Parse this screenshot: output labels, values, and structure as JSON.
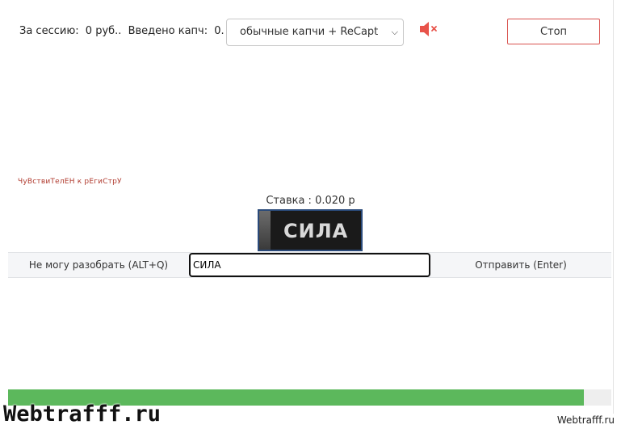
{
  "stats": {
    "session_label": "За сессию:",
    "session_value": "0 руб..",
    "entered_label": "Введено капч:",
    "entered_value": "0."
  },
  "mode_select": {
    "selected": "обычные капчи + ReCaptcha",
    "visible_text": "обычные капчи + ReCapt"
  },
  "sound": {
    "icon": "speaker-muted-icon",
    "color": "#e8534a"
  },
  "stop_button": {
    "label": "Стоп",
    "border_color": "#d9534f"
  },
  "case_note": "ЧуВствиТелЕН к рЕгиСтрУ",
  "rate": "Ставка : 0.020 р",
  "captcha": {
    "word": "СИЛА"
  },
  "answer": {
    "cant_label": "Не могу разобрать (ALT+Q)",
    "value": "СИЛА",
    "send_label": "Отправить (Enter)"
  },
  "progress": {
    "value": 0.955,
    "color": "#5cb85c"
  },
  "watermark": {
    "left": "Webtrafff.ru",
    "right": "Webtrafff.ru"
  }
}
